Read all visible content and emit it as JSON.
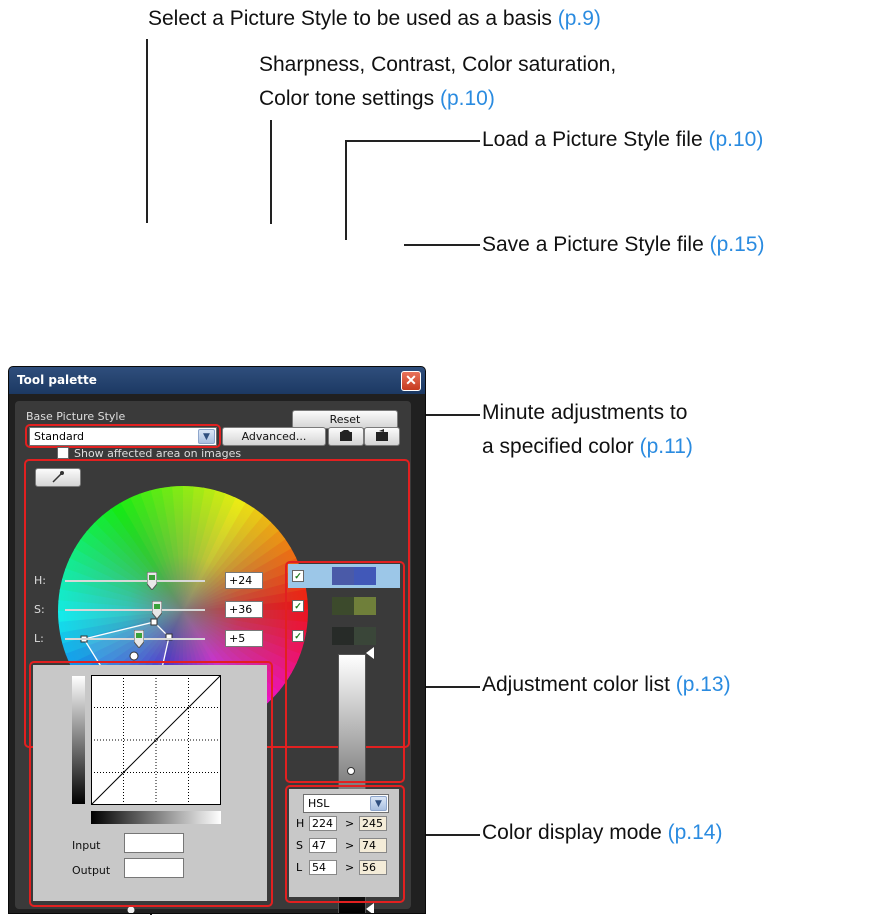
{
  "annotations": {
    "select_style": {
      "text": "Select a Picture Style to be used as a basis",
      "ref": "(p.9)"
    },
    "advanced_line1": "Sharpness, Contrast, Color saturation,",
    "advanced_line2": {
      "text": "Color tone settings",
      "ref": "(p.10)"
    },
    "load_file": {
      "text": "Load a Picture Style file",
      "ref": "(p.10)"
    },
    "save_file": {
      "text": "Save a Picture Style file",
      "ref": "(p.15)"
    },
    "minute_line1": "Minute adjustments to",
    "minute_line2": {
      "text": "a specified color",
      "ref": "(p.11)"
    },
    "color_list": {
      "text": "Adjustment color list",
      "ref": "(p.13)"
    },
    "display_mode": {
      "text": "Color display mode",
      "ref": "(p.14)"
    }
  },
  "window": {
    "title": "Tool palette",
    "close_icon": "close-icon"
  },
  "base_style": {
    "label": "Base Picture Style",
    "selected": "Standard",
    "dropdown_icon": "chevron-down-icon"
  },
  "buttons": {
    "reset": "Reset",
    "advanced": "Advanced...",
    "load_icon": "folder-open-icon",
    "save_icon": "save-icon"
  },
  "show_affected_label": "Show affected area on images",
  "eyedropper_icon": "eyedropper-icon",
  "sliders": [
    {
      "label": "H:",
      "value": "+24"
    },
    {
      "label": "S:",
      "value": "+36"
    },
    {
      "label": "L:",
      "value": "+5"
    }
  ],
  "color_list": [
    {
      "checked": true,
      "before": "#4a5aa8",
      "after": "#4158b8",
      "selected": true
    },
    {
      "checked": true,
      "before": "#3c4a2c",
      "after": "#6f7f3a",
      "selected": false
    },
    {
      "checked": true,
      "before": "#272b28",
      "after": "#3a4639",
      "selected": false
    }
  ],
  "curve": {
    "input_label": "Input",
    "output_label": "Output",
    "input_value": "",
    "output_value": ""
  },
  "display_mode": {
    "selected": "HSL",
    "rows": [
      {
        "label": "H",
        "from": "224",
        "to": "245"
      },
      {
        "label": "S",
        "from": "47",
        "to": "74"
      },
      {
        "label": "L",
        "from": "54",
        "to": "56"
      }
    ],
    "arrow": ">"
  },
  "colors": {
    "accent_red": "#e22020",
    "reference_blue": "#2a8be0",
    "title_bar": "#2f4e7c"
  }
}
